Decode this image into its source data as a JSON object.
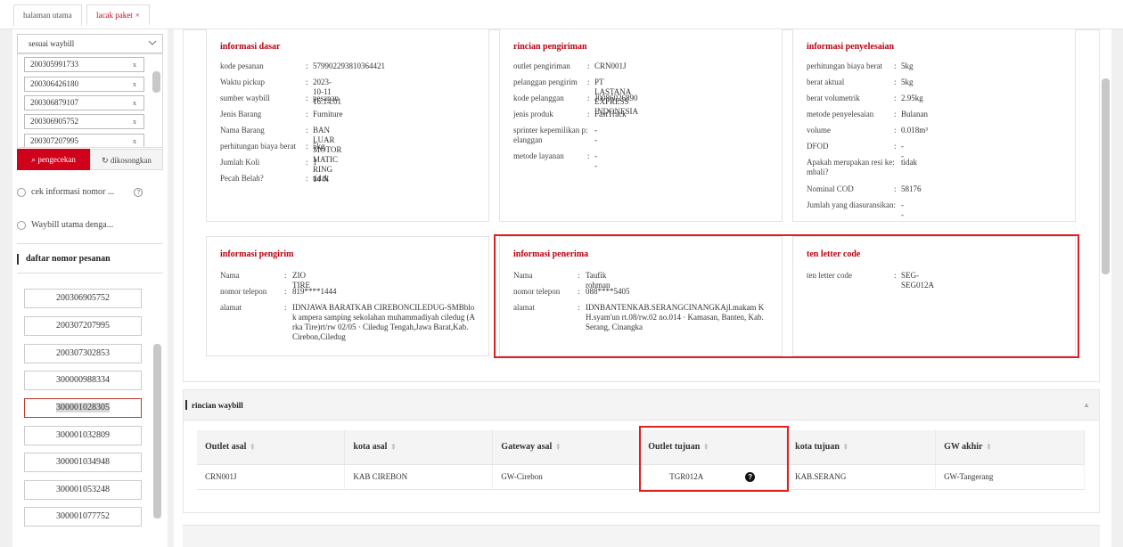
{
  "tabs": [
    {
      "label": "halaman utama"
    },
    {
      "label": "lacak paket",
      "close": "×"
    }
  ],
  "sidebar": {
    "select_value": "sesuai waybill",
    "waybills": [
      "200305991733",
      "200306426180",
      "200306879107",
      "200306905752",
      "200307207995"
    ],
    "remove_glyph": "x",
    "search_button": "pengecekan",
    "clear_button": "dikosongkan",
    "radio_options": [
      "cek informasi nomor ...",
      "Waybill utama denga..."
    ],
    "help_glyph": "?",
    "order_list_title": "daftar nomor pesanan",
    "orders": [
      "200306905752",
      "200307207995",
      "200307302853",
      "300000988334",
      "300001028305",
      "300001032809",
      "300001034948",
      "300001053248",
      "300001077752"
    ],
    "selected_order": "300001028305"
  },
  "cards": {
    "basic": {
      "title": "informasi dasar",
      "rows": [
        {
          "k": "kode pesanan",
          "v": "579902293810364421"
        },
        {
          "k": "Waktu pickup",
          "v": "2023-10-11 16:14:01"
        },
        {
          "k": "sumber waybill",
          "v": "pesanan"
        },
        {
          "k": "Jenis Barang",
          "v": "Furniture"
        },
        {
          "k": "Nama Barang",
          "v": "BAN LUAR MOTOR MATIC RING 14 N"
        },
        {
          "k": "perhitungan biaya berat",
          "v": "5kg"
        },
        {
          "k": "Jumlah Koli",
          "v": "1"
        },
        {
          "k": "Pecah Belah?",
          "v": "tidak"
        }
      ]
    },
    "shipping": {
      "title": "rincian pengiriman",
      "rows": [
        {
          "k": "outlet pengiriman",
          "v": "CRN001J"
        },
        {
          "k": "pelanggan pengirim",
          "v": "PT LASTANA EXPRESS INDONESIA"
        },
        {
          "k": "kode pelanggan",
          "v": "J0086026890"
        },
        {
          "k": "jenis produk",
          "v": "FastTrack"
        },
        {
          "k": "sprinter kepemilikan p: elanggan",
          "v": "--"
        },
        {
          "k": "metode layanan",
          "v": "--"
        }
      ]
    },
    "settlement": {
      "title": "informasi penyelesaian",
      "rows": [
        {
          "k": "perhitungan biaya berat",
          "v": "5kg"
        },
        {
          "k": "berat aktual",
          "v": "5kg"
        },
        {
          "k": "berat volumetrik",
          "v": "2.95kg"
        },
        {
          "k": "metode penyelesaian",
          "v": "Bulanan"
        },
        {
          "k": "volume",
          "v": "0.018m³"
        },
        {
          "k": "DFOD",
          "v": "--"
        },
        {
          "k": "Apakah merupakan resi ke: mbali?",
          "v": "tidak"
        },
        {
          "k": "Nominal COD",
          "v": "58176"
        },
        {
          "k": "Jumlah yang diasuransikan:",
          "v": "--"
        }
      ]
    },
    "sender": {
      "title": "informasi pengirim",
      "rows": [
        {
          "k": "Nama",
          "v": "ZIO TIRE"
        },
        {
          "k": "nomor telepon",
          "v": "819****1444"
        },
        {
          "k": "alamat",
          "v": "IDNJAWA BARATKAB CIREBONCILEDUG-SMBblok ampera samping sekolahan muhammadiyah ciledug (Arka Tire)rt/rw 02/05 · Ciledug Tengah,Jawa Barat,Kab. Cirebon,Ciledug"
        }
      ]
    },
    "receiver": {
      "title": "informasi penerima",
      "rows": [
        {
          "k": "Nama",
          "v": "Taufik rohman"
        },
        {
          "k": "nomor telepon",
          "v": "088****5405"
        },
        {
          "k": "alamat",
          "v": "IDNBANTENKAB.SERANGCINANGKAjl.makam KH.syam'un rt.08/rw.02 no.014 · Kamasan, Banten, Kab. Serang, Cinangka"
        }
      ]
    },
    "tlc": {
      "title": "ten letter code",
      "rows": [
        {
          "k": "ten letter code",
          "v": "SEG-SEG012A"
        }
      ]
    }
  },
  "waybill_detail": {
    "title": "rincian waybill",
    "collapse_glyph": "▲",
    "columns": [
      "Outlet asal",
      "kota asal",
      "Gateway asal",
      "Outlet tujuan",
      "kota tujuan",
      "GW akhir"
    ],
    "row": [
      "CRN001J",
      "KAB CIREBON",
      "GW-Cirebon",
      "TGR012A",
      "KAB.SERANG",
      "GW-Tangerang"
    ],
    "badge": "?"
  },
  "colors": {
    "accent": "#d0021b",
    "highlight_box": "#e02020"
  }
}
